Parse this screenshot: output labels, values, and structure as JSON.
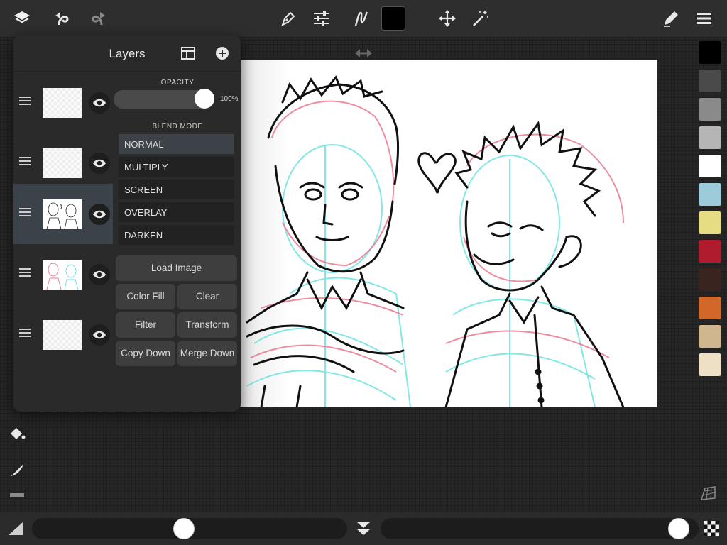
{
  "toolbar": {
    "left_icons": [
      "layers-icon",
      "undo-icon",
      "redo-icon"
    ],
    "center_icons": [
      "pen-icon",
      "sliders-icon",
      "stroke-icon",
      "color-swatch",
      "move-icon",
      "magic-wand-icon"
    ],
    "right_icons": [
      "pencil-edit-icon",
      "menu-icon"
    ],
    "current_color": "#000000"
  },
  "layers_panel": {
    "title": "Layers",
    "opacity_label": "OPACITY",
    "opacity_value": "100%",
    "opacity_level": 1.0,
    "blend_mode_label": "BLEND MODE",
    "blend_modes": [
      "NORMAL",
      "MULTIPLY",
      "SCREEN",
      "OVERLAY",
      "DARKEN"
    ],
    "selected_blend": "NORMAL",
    "buttons": {
      "load_image": "Load Image",
      "color_fill": "Color Fill",
      "clear": "Clear",
      "filter": "Filter",
      "transform": "Transform",
      "copy_down": "Copy Down",
      "merge_down": "Merge Down"
    },
    "layer_count": 5,
    "selected_layer_index": 2
  },
  "palette": [
    "#000000",
    "#4a4a4a",
    "#8a8a8a",
    "#b5b5b5",
    "#ffffff",
    "#9ccbd9",
    "#e6dc84",
    "#b01c2e",
    "#3a2420",
    "#d2672a",
    "#cfb68e",
    "#eee0c4"
  ],
  "bottom": {
    "brush_size_level": 0.48,
    "brush_opacity_level": 0.97
  }
}
